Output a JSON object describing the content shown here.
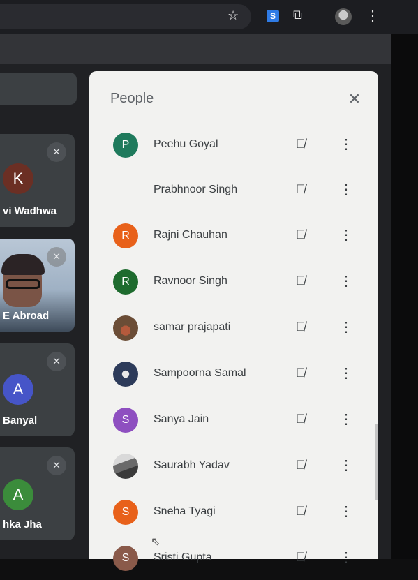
{
  "toolbar": {
    "bookmark_icon": "star-outline-icon",
    "extension_icon": "extension-s-icon",
    "extension_label": "S",
    "extensions_icon": "puzzle-icon",
    "menu_icon": "more-vert-icon"
  },
  "tiles": [
    {
      "initial": "K",
      "name": "vi Wadhwa",
      "color": "#6b2f24",
      "muted": true
    },
    {
      "initial": "",
      "name": "E Abroad",
      "color": "",
      "muted": true,
      "video": true
    },
    {
      "initial": "A",
      "name": "Banyal",
      "color": "#4655c8",
      "muted": true
    },
    {
      "initial": "A",
      "name": "hka Jha",
      "color": "#3b8c3b",
      "muted": true
    }
  ],
  "panel": {
    "title": "People",
    "close_icon": "close-icon"
  },
  "participants": [
    {
      "initial": "P",
      "name": "Peehu Goyal",
      "color": "#1f7a5c"
    },
    {
      "initial": "",
      "name": "Prabhnoor Singh",
      "color": ""
    },
    {
      "initial": "R",
      "name": "Rajni Chauhan",
      "color": "#e8611a"
    },
    {
      "initial": "R",
      "name": "Ravnoor Singh",
      "color": "#1e6b2e"
    },
    {
      "initial": "",
      "name": "samar prajapati",
      "color": "photo4"
    },
    {
      "initial": "",
      "name": "Sampoorna Samal",
      "color": "photo2"
    },
    {
      "initial": "S",
      "name": "Sanya Jain",
      "color": "#8e4fc0"
    },
    {
      "initial": "",
      "name": "Saurabh Yadav",
      "color": "photo3"
    },
    {
      "initial": "S",
      "name": "Sneha Tyagi",
      "color": "#e8611a"
    },
    {
      "initial": "S",
      "name": "Sristi Gupta",
      "color": "#8a5a4a"
    }
  ]
}
